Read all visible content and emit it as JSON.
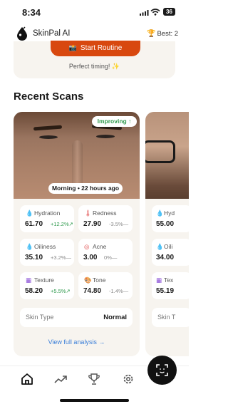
{
  "status_bar": {
    "time": "8:34",
    "battery": "36"
  },
  "header": {
    "app_name": "SkinPal AI",
    "best_label": "Best: 2"
  },
  "routine": {
    "start_label": "Start Routine",
    "hint": "Perfect timing! ✨"
  },
  "recent_scans": {
    "title": "Recent Scans",
    "cards": [
      {
        "badge": "Improving ↑",
        "time_label": "Morning • 22 hours ago",
        "metrics": [
          {
            "icon": "droplet-icon",
            "label": "Hydration",
            "value": "61.70",
            "change": "+12.2%↗",
            "trend": "up"
          },
          {
            "icon": "thermometer-icon",
            "label": "Redness",
            "value": "27.90",
            "change": "-3.5%—",
            "trend": "flat"
          },
          {
            "icon": "oil-drop-icon",
            "label": "Oiliness",
            "value": "35.10",
            "change": "+3.2%—",
            "trend": "flat"
          },
          {
            "icon": "acne-icon",
            "label": "Acne",
            "value": "3.00",
            "change": "0%—",
            "trend": "flat"
          },
          {
            "icon": "texture-grid-icon",
            "label": "Texture",
            "value": "58.20",
            "change": "+5.5%↗",
            "trend": "up"
          },
          {
            "icon": "palette-icon",
            "label": "Tone",
            "value": "74.80",
            "change": "-1.4%—",
            "trend": "flat"
          }
        ],
        "skin_type_label": "Skin Type",
        "skin_type_value": "Normal",
        "view_link": "View full analysis →"
      },
      {
        "metrics": [
          {
            "label": "Hyd",
            "value": "55.00"
          },
          {
            "label": "Oili",
            "value": "34.00"
          },
          {
            "label": "Tex",
            "value": "55.19"
          }
        ],
        "skin_type_label": "Skin T"
      }
    ]
  },
  "nav": {
    "items": [
      "home-icon",
      "trends-icon",
      "trophy-icon",
      "settings-icon"
    ],
    "fab": "face-scan-icon"
  },
  "colors": {
    "accent": "#d8480f",
    "positive": "#2f9a4d",
    "link": "#3b7fd9",
    "card_bg": "#f7f4ef"
  }
}
